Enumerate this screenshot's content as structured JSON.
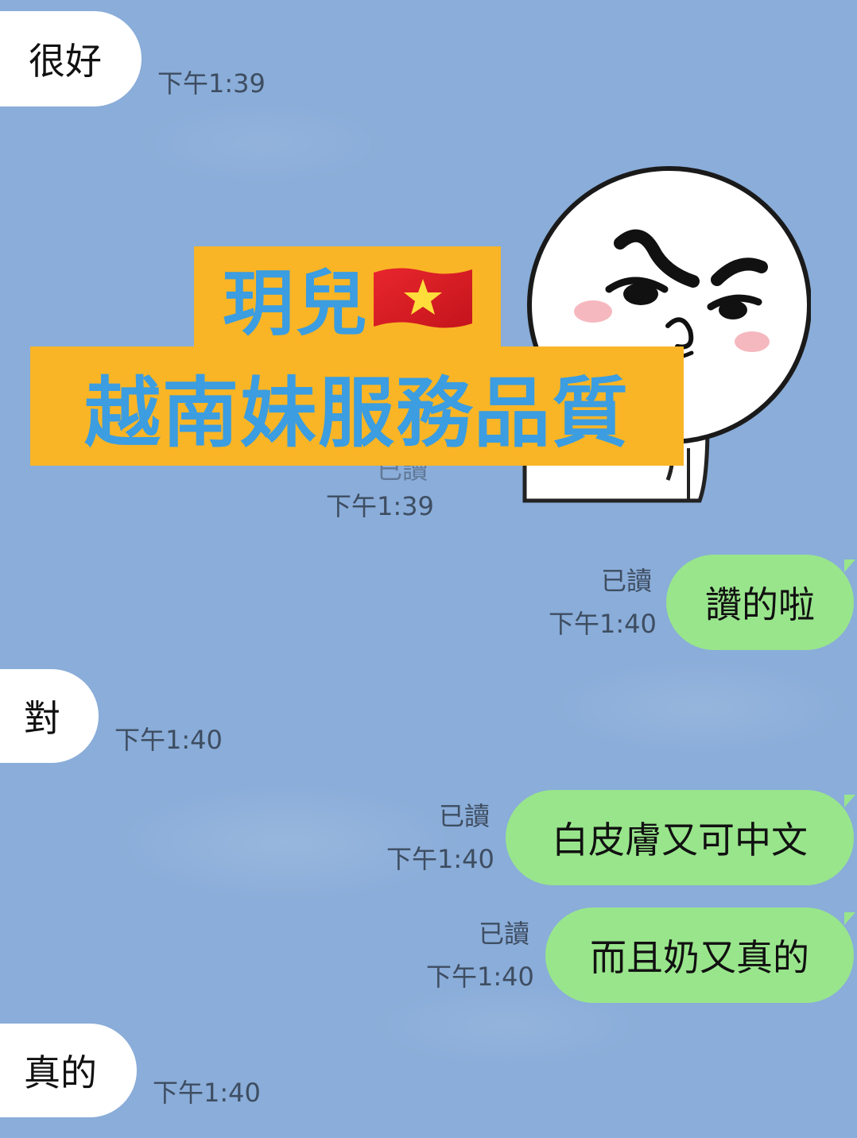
{
  "messages": {
    "m1": {
      "text": "很好",
      "time": "下午1:39"
    },
    "sticker": {
      "name": "brown-moon-smirk-sticker",
      "read": "已讀",
      "time": "下午1:39"
    },
    "m2": {
      "text": "讚的啦",
      "read": "已讀",
      "time": "下午1:40"
    },
    "m3": {
      "text": "對",
      "time": "下午1:40"
    },
    "m4": {
      "text": "白皮膚又可中文",
      "read": "已讀",
      "time": "下午1:40"
    },
    "m5": {
      "text": "而且奶又真的",
      "read": "已讀",
      "time": "下午1:40"
    },
    "m6": {
      "text": "真的",
      "time": "下午1:40"
    }
  },
  "overlay": {
    "line1": "玥兒",
    "line2": "越南妹服務品質",
    "flag_icon": "vietnam-flag-icon",
    "banner_color": "#f9b526",
    "text_color": "#3c9de0"
  },
  "colors": {
    "background": "#8aadd9",
    "incoming_bubble": "#ffffff",
    "outgoing_bubble": "#99e58c"
  }
}
